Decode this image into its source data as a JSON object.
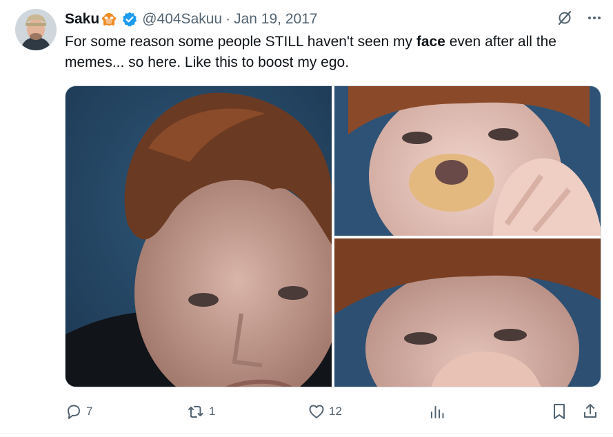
{
  "tweet": {
    "author_name": "Saku",
    "handle": "@404Sakuu",
    "separator": "·",
    "date": "Jan 19, 2017",
    "text_before": "For some reason some people STILL haven't seen my ",
    "text_bold": "face",
    "text_after": " even after all the memes... so here. Like this to boost my ego."
  },
  "stats": {
    "replies": "7",
    "retweets": "1",
    "likes": "12"
  },
  "colors": {
    "verified_blue": "#1d9bf0",
    "text_primary": "#0f1419",
    "text_secondary": "#536471",
    "border": "#cfd9de"
  },
  "icons": {
    "header": [
      "monkey-emoji-icon",
      "verified-badge-icon",
      "grok-icon",
      "more-icon"
    ],
    "actions": [
      "reply-icon",
      "retweet-icon",
      "like-icon",
      "views-icon",
      "bookmark-icon",
      "share-icon"
    ]
  }
}
